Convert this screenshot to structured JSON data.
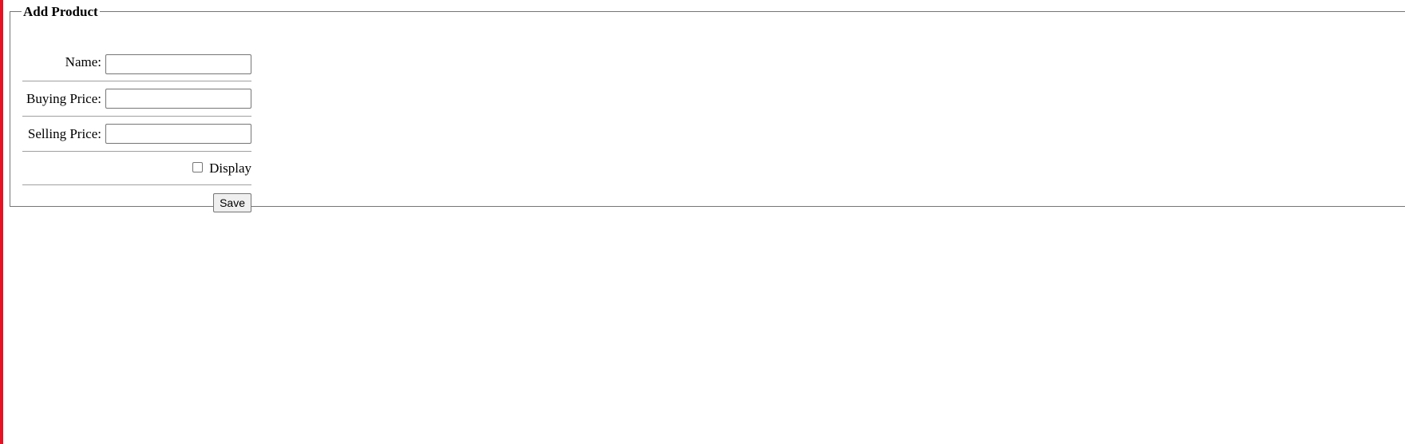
{
  "form": {
    "title": "Add Product",
    "fields": [
      {
        "label": "Name:",
        "value": ""
      },
      {
        "label": "Buying Price:",
        "value": ""
      },
      {
        "label": "Selling Price:",
        "value": ""
      }
    ],
    "display_checkbox": {
      "label": "Display",
      "checked": false
    },
    "save_label": "Save"
  },
  "colors": {
    "left_accent": "#e81123",
    "border": "#767676",
    "divider": "#a0a0a0"
  }
}
